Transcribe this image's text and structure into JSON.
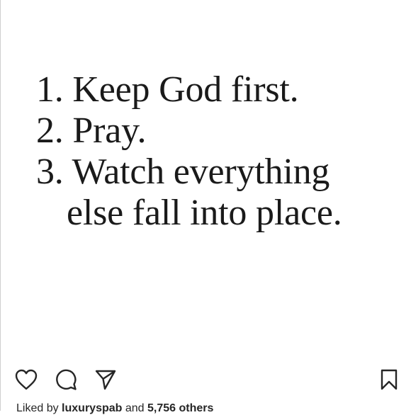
{
  "post": {
    "quote": {
      "items": [
        {
          "number": "1.",
          "text": "Keep God first."
        },
        {
          "number": "2.",
          "text": "Pray."
        },
        {
          "number": "3.",
          "text": "Watch everything",
          "continuation": "else fall into place."
        }
      ]
    },
    "actions": {
      "like_icon": "heart-outline-icon",
      "comment_icon": "speech-bubble-icon",
      "share_icon": "paper-plane-icon",
      "save_icon": "bookmark-outline-icon"
    },
    "likes": {
      "prefix": "Liked by",
      "username": "luxuryspab",
      "middle": "and",
      "count": "5,756 others"
    }
  },
  "colors": {
    "text": "#1a1a1a",
    "icon": "#262626",
    "background": "#ffffff"
  }
}
